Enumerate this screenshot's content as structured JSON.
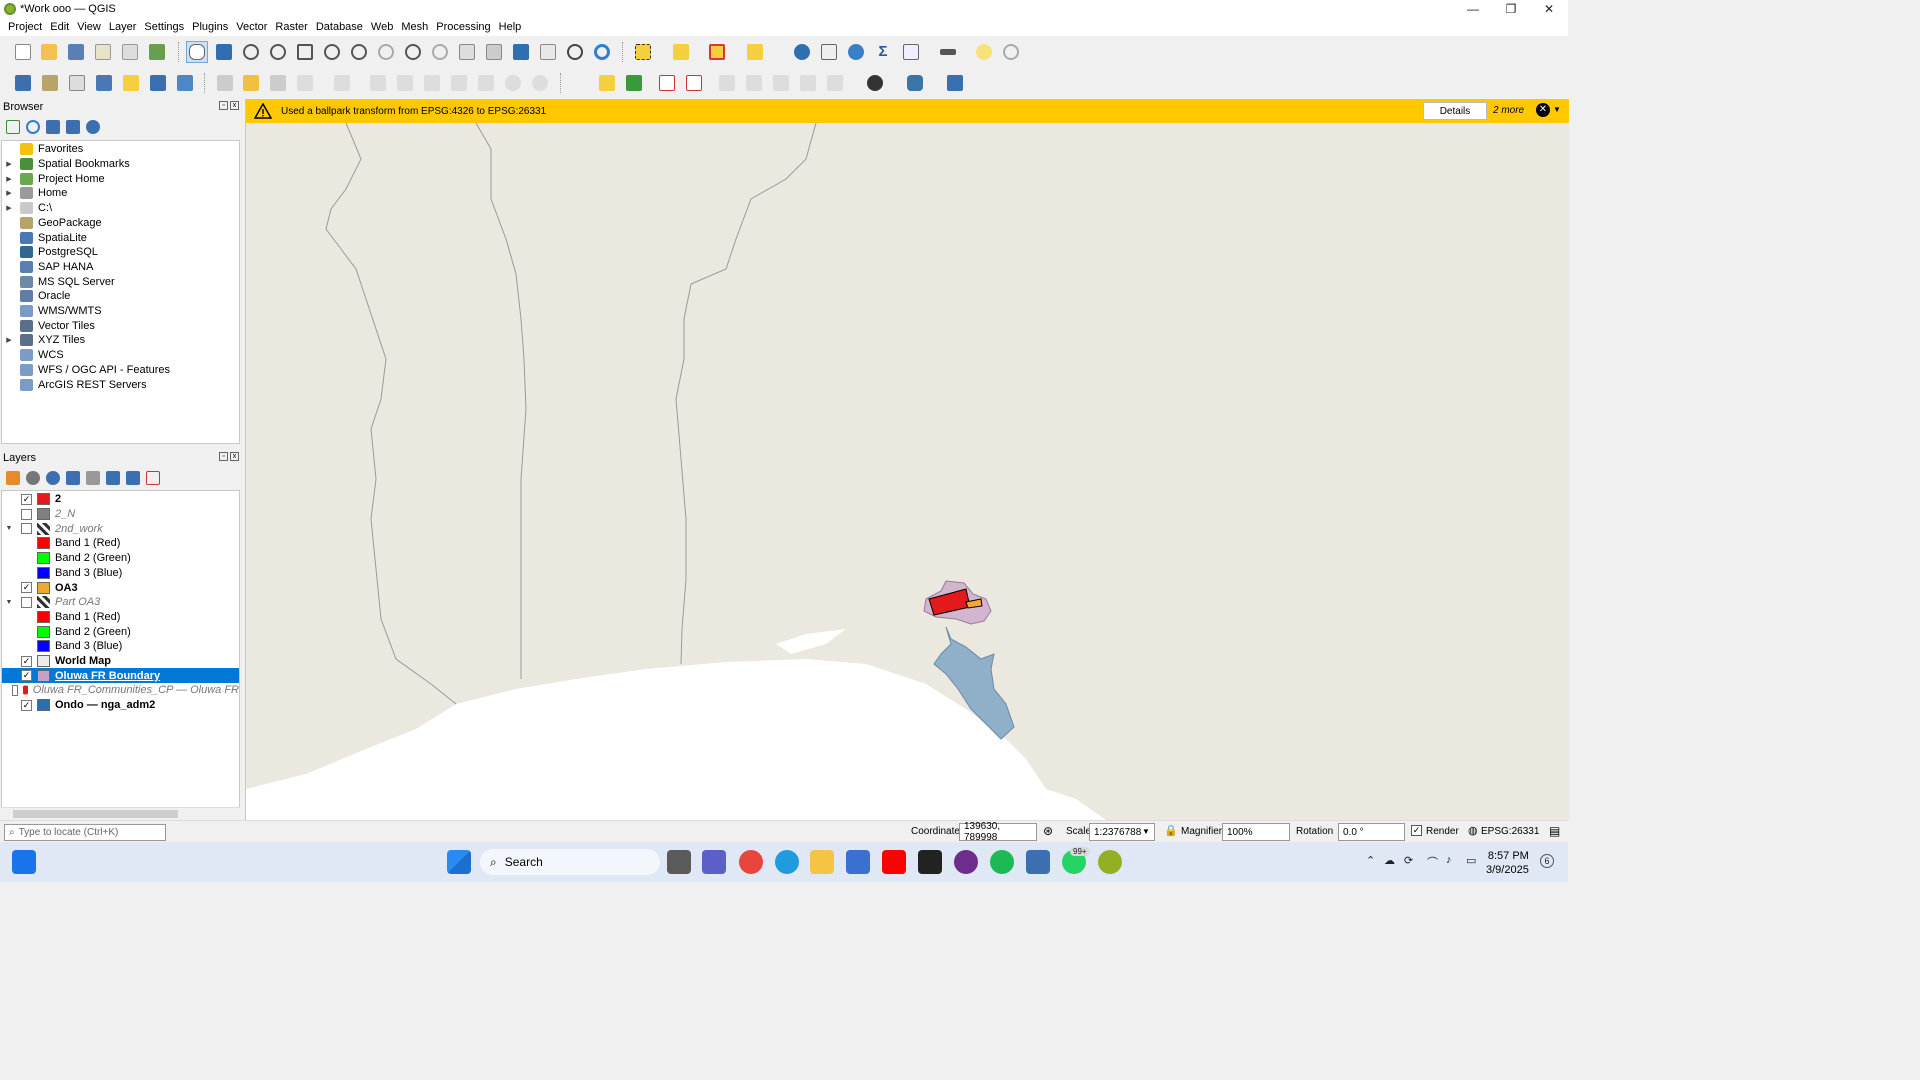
{
  "window": {
    "title": "*Work ooo — QGIS",
    "min": "—",
    "max": "❐",
    "close": "✕"
  },
  "menu": [
    "Project",
    "Edit",
    "View",
    "Layer",
    "Settings",
    "Plugins",
    "Vector",
    "Raster",
    "Database",
    "Web",
    "Mesh",
    "Processing",
    "Help"
  ],
  "browser": {
    "title": "Browser",
    "items": [
      {
        "label": "Favorites",
        "expandable": false,
        "color": "#f4c20d"
      },
      {
        "label": "Spatial Bookmarks",
        "expandable": true,
        "color": "#4b8f3c"
      },
      {
        "label": "Project Home",
        "expandable": true,
        "color": "#6aa84f"
      },
      {
        "label": "Home",
        "expandable": true,
        "color": "#9a9a9a"
      },
      {
        "label": "C:\\",
        "expandable": true,
        "color": "#c9c9c9"
      },
      {
        "label": "GeoPackage",
        "expandable": false,
        "color": "#b8a36a"
      },
      {
        "label": "SpatiaLite",
        "expandable": false,
        "color": "#4a78b5"
      },
      {
        "label": "PostgreSQL",
        "expandable": false,
        "color": "#336791"
      },
      {
        "label": "SAP HANA",
        "expandable": false,
        "color": "#5d7fb0"
      },
      {
        "label": "MS SQL Server",
        "expandable": false,
        "color": "#6e88a8"
      },
      {
        "label": "Oracle",
        "expandable": false,
        "color": "#5f7da6"
      },
      {
        "label": "WMS/WMTS",
        "expandable": false,
        "color": "#7a9cc6"
      },
      {
        "label": "Vector Tiles",
        "expandable": false,
        "color": "#5b6f8c"
      },
      {
        "label": "XYZ Tiles",
        "expandable": true,
        "color": "#5b6f8c"
      },
      {
        "label": "WCS",
        "expandable": false,
        "color": "#7a9cc6"
      },
      {
        "label": "WFS / OGC API - Features",
        "expandable": false,
        "color": "#7a9cc6"
      },
      {
        "label": "ArcGIS REST Servers",
        "expandable": false,
        "color": "#7a9cc6"
      }
    ]
  },
  "layers": {
    "title": "Layers",
    "items": [
      {
        "label": "2",
        "checked": true,
        "arrow": "",
        "indent": 0,
        "symbol": "#e31a1c",
        "style": "bold"
      },
      {
        "label": "2_N",
        "checked": false,
        "arrow": "",
        "indent": 0,
        "symbol": "#808080",
        "style": "italic"
      },
      {
        "label": "2nd_work",
        "checked": false,
        "arrow": "▼",
        "indent": 0,
        "symbol": "raster",
        "style": "italic"
      },
      {
        "label": "Band 1 (Red)",
        "checked": null,
        "arrow": "",
        "indent": 1,
        "symbol": "#ff0000",
        "style": ""
      },
      {
        "label": "Band 2 (Green)",
        "checked": null,
        "arrow": "",
        "indent": 1,
        "symbol": "#00ff00",
        "style": ""
      },
      {
        "label": "Band 3 (Blue)",
        "checked": null,
        "arrow": "",
        "indent": 1,
        "symbol": "#0000ff",
        "style": ""
      },
      {
        "label": "OA3",
        "checked": true,
        "arrow": "",
        "indent": 0,
        "symbol": "#f0a830",
        "style": "bold"
      },
      {
        "label": "Part OA3",
        "checked": false,
        "arrow": "▼",
        "indent": 0,
        "symbol": "raster",
        "style": "italic"
      },
      {
        "label": "Band 1 (Red)",
        "checked": null,
        "arrow": "",
        "indent": 1,
        "symbol": "#ff0000",
        "style": ""
      },
      {
        "label": "Band 2 (Green)",
        "checked": null,
        "arrow": "",
        "indent": 1,
        "symbol": "#00ff00",
        "style": ""
      },
      {
        "label": "Band 3 (Blue)",
        "checked": null,
        "arrow": "",
        "indent": 1,
        "symbol": "#0000ff",
        "style": ""
      },
      {
        "label": "World Map",
        "checked": true,
        "arrow": "",
        "indent": 0,
        "symbol": "#ececec",
        "style": "bold"
      },
      {
        "label": "Oluwa FR Boundary",
        "checked": true,
        "arrow": "",
        "indent": 0,
        "symbol": "#c7a0c7",
        "style": "bold",
        "selected": true
      },
      {
        "label": "Oluwa FR_Communities_CP — Oluwa FR",
        "checked": false,
        "arrow": "",
        "indent": 0,
        "symbol": "point",
        "style": "italic"
      },
      {
        "label": "Ondo — nga_adm2",
        "checked": true,
        "arrow": "",
        "indent": 0,
        "symbol": "#2a6fb0",
        "style": "bold"
      }
    ]
  },
  "message_bar": {
    "text": "Used a ballpark transform from EPSG:4326 to EPSG:26331",
    "details_label": "Details",
    "more_label": "2 more",
    "close": "✕",
    "color": "#ffc800"
  },
  "status": {
    "locator_placeholder": "Type to locate (Ctrl+K)",
    "coordinate_label": "Coordinate",
    "coordinate_value": "139630, 789998",
    "scale_label": "Scale",
    "scale_value": "1:2376788",
    "magnifier_label": "Magnifier",
    "magnifier_value": "100%",
    "rotation_label": "Rotation",
    "rotation_value": "0.0 °",
    "render_label": "Render",
    "crs": "EPSG:26331"
  },
  "taskbar": {
    "search_label": "Search",
    "time": "8:57 PM",
    "date": "3/9/2025",
    "badge": "99+",
    "notif": "6"
  },
  "map_colors": {
    "land": "#ebe8df",
    "water": "#ffffff",
    "boundary": "#c7a0c7",
    "ondo": "#8fb0c8",
    "red": "#e31a1c"
  }
}
